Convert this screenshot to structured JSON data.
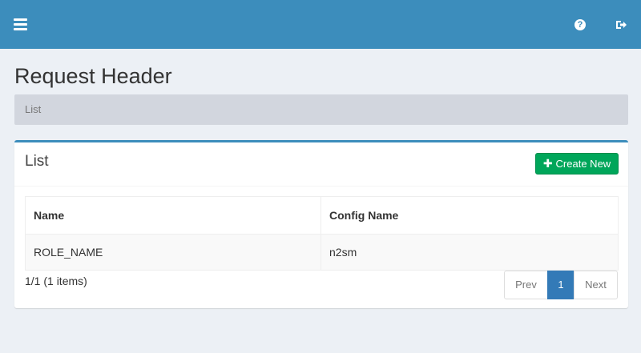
{
  "header": {
    "menu_icon": "hamburger-icon",
    "help_icon": "question-circle-icon",
    "help_glyph": "?",
    "logout_icon": "sign-out-icon"
  },
  "page": {
    "title": "Request Header",
    "breadcrumb": "List"
  },
  "box": {
    "title": "List",
    "create_label": "Create New",
    "create_icon": "plus-icon"
  },
  "table": {
    "columns": [
      "Name",
      "Config Name"
    ],
    "rows": [
      [
        "ROLE_NAME",
        "n2sm"
      ]
    ]
  },
  "summary": "1/1 (1 items)",
  "pagination": {
    "prev": "Prev",
    "current": "1",
    "next": "Next"
  },
  "colors": {
    "primary": "#3c8dbc",
    "success": "#00a65a",
    "page_active": "#337ab7",
    "background": "#ecf0f5"
  }
}
